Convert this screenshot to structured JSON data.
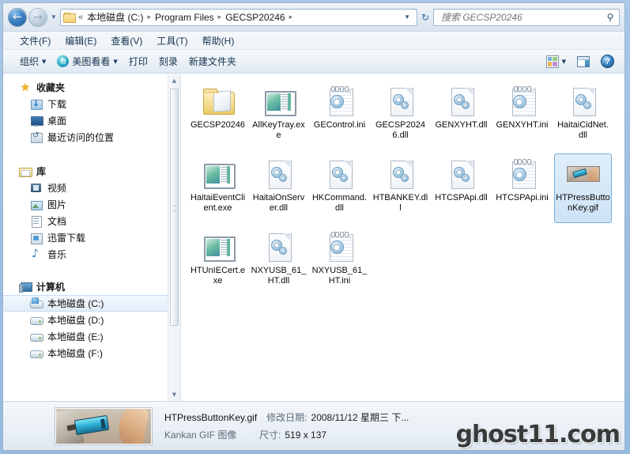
{
  "window": {
    "nav": {
      "back_label": "←",
      "forward_label": "→",
      "history_caret": "▼",
      "refresh_label": "↻"
    },
    "address": {
      "root_chevron": "«",
      "crumbs": [
        "本地磁盘 (C:)",
        "Program Files",
        "GECSP20246"
      ],
      "separator": "▸",
      "dropdown_caret": "▼"
    },
    "search": {
      "placeholder": "搜索 GECSP20246",
      "value": "",
      "icon": "search-icon",
      "icon_glyph": "⚲"
    }
  },
  "menubar": [
    {
      "label": "文件(F)"
    },
    {
      "label": "编辑(E)"
    },
    {
      "label": "查看(V)"
    },
    {
      "label": "工具(T)"
    },
    {
      "label": "帮助(H)"
    }
  ],
  "toolbar": {
    "organize_label": "组织",
    "meitu_label": "美图看看",
    "meitu_icon_char": "看",
    "print_label": "打印",
    "burn_label": "刻录",
    "newfolder_label": "新建文件夹",
    "caret": "▼",
    "views_icon": "views-icon",
    "preview_icon": "preview-pane-icon",
    "help_icon": "help-icon",
    "help_glyph": "?"
  },
  "sidebar": {
    "groups": [
      {
        "header": {
          "label": "收藏夹",
          "icon": "star-icon"
        },
        "items": [
          {
            "label": "下载",
            "icon": "download-icon"
          },
          {
            "label": "桌面",
            "icon": "desktop-icon"
          },
          {
            "label": "最近访问的位置",
            "icon": "recent-places-icon"
          }
        ]
      },
      {
        "header": {
          "label": "库",
          "icon": "library-icon"
        },
        "items": [
          {
            "label": "视频",
            "icon": "video-icon"
          },
          {
            "label": "图片",
            "icon": "pictures-icon"
          },
          {
            "label": "文档",
            "icon": "documents-icon"
          },
          {
            "label": "迅雷下载",
            "icon": "xunlei-download-icon"
          },
          {
            "label": "音乐",
            "icon": "music-icon"
          }
        ]
      },
      {
        "header": {
          "label": "计算机",
          "icon": "computer-icon"
        },
        "items": [
          {
            "label": "本地磁盘 (C:)",
            "icon": "system-drive-icon",
            "selected": true
          },
          {
            "label": "本地磁盘 (D:)",
            "icon": "drive-icon",
            "selected": false
          },
          {
            "label": "本地磁盘 (E:)",
            "icon": "drive-icon",
            "selected": false
          },
          {
            "label": "本地磁盘 (F:)",
            "icon": "drive-icon",
            "selected": false
          }
        ]
      }
    ],
    "scrollbar": {
      "up_arrow": "▲",
      "down_arrow": "▼"
    }
  },
  "files": [
    {
      "name": "GECSP20246",
      "type": "folder",
      "selected": false
    },
    {
      "name": "AllKeyTray.exe",
      "type": "exe",
      "selected": false
    },
    {
      "name": "GEControl.ini",
      "type": "ini",
      "selected": false
    },
    {
      "name": "GECSP20246.dll",
      "type": "dll",
      "selected": false
    },
    {
      "name": "GENXYHT.dll",
      "type": "dll",
      "selected": false
    },
    {
      "name": "GENXYHT.ini",
      "type": "ini",
      "selected": false
    },
    {
      "name": "HaitaiCidNet.dll",
      "type": "dll",
      "selected": false
    },
    {
      "name": "HaitaiEventClient.exe",
      "type": "exe",
      "selected": false
    },
    {
      "name": "HaitaiOnServer.dll",
      "type": "dll",
      "selected": false
    },
    {
      "name": "HKCommand.dll",
      "type": "dll",
      "selected": false
    },
    {
      "name": "HTBANKEY.dll",
      "type": "dll",
      "selected": false
    },
    {
      "name": "HTCSPApi.dll",
      "type": "dll",
      "selected": false
    },
    {
      "name": "HTCSPApi.ini",
      "type": "ini",
      "selected": false
    },
    {
      "name": "HTPressButtonKey.gif",
      "type": "gif",
      "selected": true
    },
    {
      "name": "HTUnIECert.exe",
      "type": "exe",
      "selected": false
    },
    {
      "name": "NXYUSB_61_HT.dll",
      "type": "dll",
      "selected": false
    },
    {
      "name": "NXYUSB_61_HT.ini",
      "type": "ini",
      "selected": false
    }
  ],
  "details": {
    "filename": "HTPressButtonKey.gif",
    "filetype": "Kankan GIF 图像",
    "modified_key": "修改日期:",
    "modified_value": "2008/11/12 星期三 下...",
    "size_key": "尺寸:",
    "size_value": "519 x 137"
  },
  "watermark": {
    "text": "ghost11.com"
  }
}
